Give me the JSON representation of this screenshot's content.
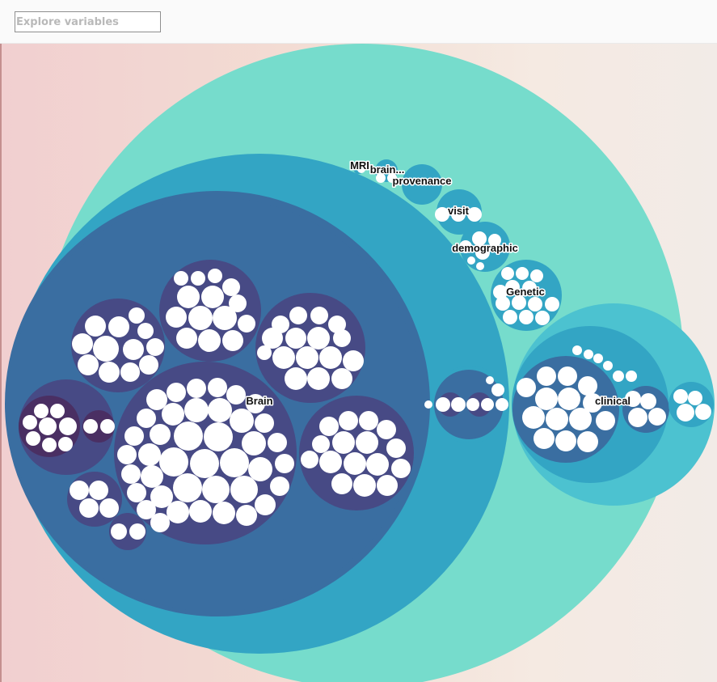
{
  "search": {
    "placeholder": "Explore variables",
    "value": ""
  },
  "bubble_labels": {
    "mri": "MRI",
    "brain_trunc": "brain...",
    "provenance": "provenance",
    "visit": "visit",
    "demographic": "demographic",
    "genetic": "Genetic",
    "brain": "Brain",
    "clinical": "clinical"
  },
  "colors": {
    "root": "#76dccc",
    "depth1": "#33a5c4",
    "depth2": "#3a6ea1",
    "depth3": "#474a85",
    "depth4": "#4a2f63",
    "leaf": "#ffffff",
    "clinical_outer": "#4cc2d0"
  }
}
